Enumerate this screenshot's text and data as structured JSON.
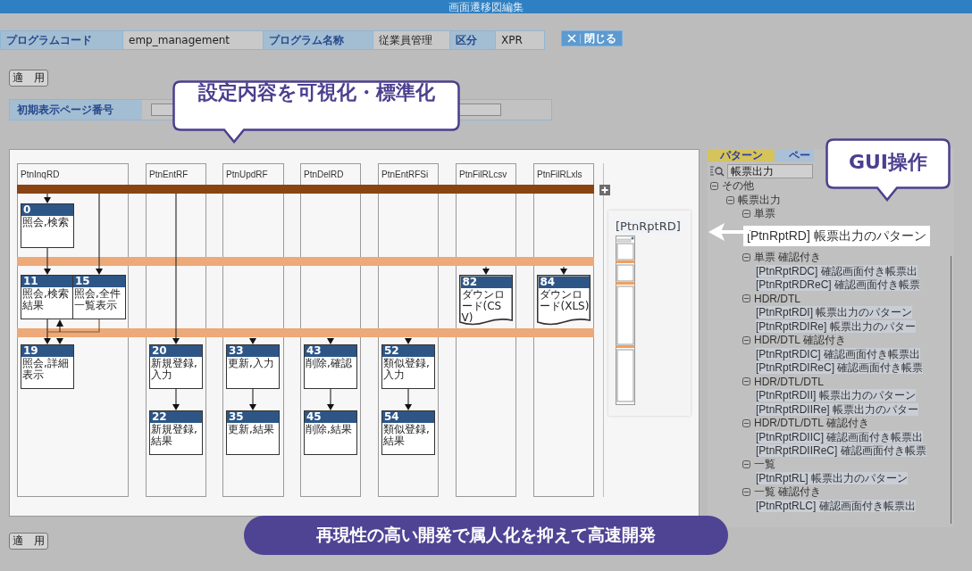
{
  "window": {
    "title": "画面遷移図編集"
  },
  "header": [
    {
      "label": "プログラムコード",
      "value": "emp_management"
    },
    {
      "label": "プログラム名称",
      "value": "従業員管理"
    },
    {
      "label": "区分",
      "value": "XPR"
    }
  ],
  "close_button": {
    "label": "閉じる"
  },
  "apply_button": {
    "label": "適　用"
  },
  "initial_page": {
    "label": "初期表示ページ番号"
  },
  "lanes": [
    {
      "name": "PtnInqRD",
      "nodes": [
        {
          "number": "0",
          "label": "照会,検索",
          "kind": "screen"
        },
        {
          "number": "11",
          "label": "照会,検索結果",
          "kind": "screen"
        },
        {
          "number": "15",
          "label": "照会,全件一覧表示",
          "kind": "screen"
        },
        {
          "number": "19",
          "label": "照会,詳細表示",
          "kind": "screen"
        }
      ]
    },
    {
      "name": "PtnEntRF",
      "nodes": [
        {
          "number": "20",
          "label": "新規登録,入力",
          "kind": "screen"
        },
        {
          "number": "22",
          "label": "新規登録,結果",
          "kind": "screen"
        }
      ]
    },
    {
      "name": "PtnUpdRF",
      "nodes": [
        {
          "number": "33",
          "label": "更新,入力",
          "kind": "screen"
        },
        {
          "number": "35",
          "label": "更新,結果",
          "kind": "screen"
        }
      ]
    },
    {
      "name": "PtnDelRD",
      "nodes": [
        {
          "number": "43",
          "label": "削除,確認",
          "kind": "screen"
        },
        {
          "number": "45",
          "label": "削除,結果",
          "kind": "screen"
        }
      ]
    },
    {
      "name": "PtnEntRFSi",
      "nodes": [
        {
          "number": "52",
          "label": "類似登録,入力",
          "kind": "screen"
        },
        {
          "number": "54",
          "label": "類似登録,結果",
          "kind": "screen"
        }
      ]
    },
    {
      "name": "PtnFilRLcsv",
      "nodes": [
        {
          "number": "82",
          "label": "ダウンロード(CSV)",
          "kind": "download"
        }
      ]
    },
    {
      "name": "PtnFilRLxls",
      "nodes": [
        {
          "number": "84",
          "label": "ダウンロード(XLS)",
          "kind": "download"
        }
      ]
    }
  ],
  "preview": {
    "title": "[PtnRptRD]"
  },
  "panel_tabs": [
    {
      "label": "パターン",
      "selected": true
    },
    {
      "label": "ペー",
      "selected": false
    }
  ],
  "search": {
    "value": "帳票出力"
  },
  "tree": [
    {
      "label": "その他",
      "expanded": true,
      "children": [
        {
          "label": "帳票出力",
          "expanded": true,
          "children": [
            {
              "label": "単票",
              "expanded": true,
              "children": [
                {
                  "label": "[PtnRptRD] 帳票出力のパターン",
                  "highlighted": true
                }
              ]
            },
            {
              "label": "単票 確認付き",
              "expanded": true,
              "children": [
                {
                  "label": "[PtnRptRDC] 確認画面付き帳票出",
                  "highlighted": false
                },
                {
                  "label": "[PtnRptRDReC] 確認画面付き帳票",
                  "highlighted": false
                }
              ]
            },
            {
              "label": "HDR/DTL",
              "expanded": true,
              "children": [
                {
                  "label": "[PtnRptRDI] 帳票出力のパターン",
                  "highlighted": false
                },
                {
                  "label": "[PtnRptRDIRe] 帳票出力のパター",
                  "highlighted": false
                }
              ]
            },
            {
              "label": "HDR/DTL 確認付き",
              "expanded": true,
              "children": [
                {
                  "label": "[PtnRptRDIC] 確認画面付き帳票出",
                  "highlighted": false
                },
                {
                  "label": "[PtnRptRDIReC] 確認画面付き帳票",
                  "highlighted": false
                }
              ]
            },
            {
              "label": "HDR/DTL/DTL",
              "expanded": true,
              "children": [
                {
                  "label": "[PtnRptRDII] 帳票出力のパターン",
                  "highlighted": false
                },
                {
                  "label": "[PtnRptRDIIRe] 帳票出力のパター",
                  "highlighted": false
                }
              ]
            },
            {
              "label": "HDR/DTL/DTL 確認付き",
              "expanded": true,
              "children": [
                {
                  "label": "[PtnRptRDIIC] 確認画面付き帳票出",
                  "highlighted": false
                },
                {
                  "label": "[PtnRptRDIIReC] 確認画面付き帳票",
                  "highlighted": false
                }
              ]
            },
            {
              "label": "一覧",
              "expanded": true,
              "children": [
                {
                  "label": "[PtnRptRL] 帳票出力のパターン",
                  "highlighted": false
                }
              ]
            },
            {
              "label": "一覧 確認付き",
              "expanded": true,
              "children": [
                {
                  "label": "[PtnRptRLC] 確認画面付き帳票出",
                  "highlighted": false
                }
              ]
            }
          ]
        }
      ]
    }
  ],
  "callout_top": {
    "text": "設定内容を可視化・標準化"
  },
  "callout_gui": {
    "text": "GUI操作"
  },
  "banner": {
    "text": "再現性の高い開発で属人化を抑えて高速開発"
  },
  "bottom_apply_button": {
    "label": "適　用"
  }
}
